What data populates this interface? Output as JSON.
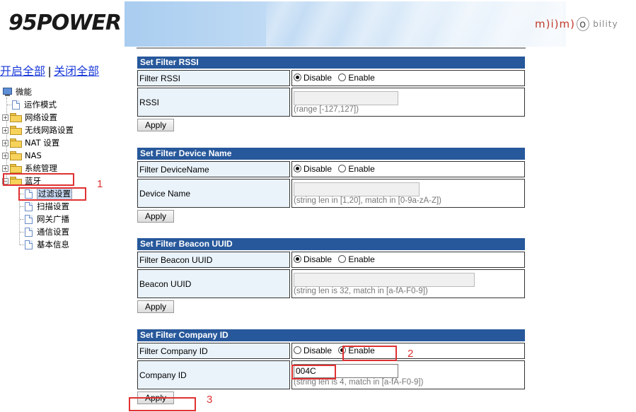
{
  "header": {
    "logo_text": "95POWER",
    "brand2": {
      "m": "m",
      "i": "i",
      "m2": "m",
      "o": "o",
      "rest": "bility"
    }
  },
  "toplinks": {
    "open_all": "开启全部",
    "separator": "|",
    "close_all": "关闭全部"
  },
  "tree": {
    "root": "微能",
    "items": [
      {
        "label": "运作模式"
      },
      {
        "label": "网络设置"
      },
      {
        "label": "无线网路设置"
      },
      {
        "label": "NAT 设置"
      },
      {
        "label": "NAS"
      },
      {
        "label": "系统管理"
      },
      {
        "label": "蓝牙"
      }
    ],
    "bluetooth_children": [
      {
        "label": "过滤设置"
      },
      {
        "label": "扫描设置"
      },
      {
        "label": "网关广播"
      },
      {
        "label": "通信设置"
      },
      {
        "label": "基本信息"
      }
    ]
  },
  "annotations": {
    "n1": "1",
    "n2": "2",
    "n3": "3"
  },
  "sections": {
    "rssi": {
      "title": "Set Filter RSSI",
      "row1_label": "Filter RSSI",
      "row2_label": "RSSI",
      "disable": "Disable",
      "enable": "Enable",
      "selected": "Disable",
      "value": "",
      "hint": "(range [-127,127])",
      "apply": "Apply"
    },
    "devname": {
      "title": "Set Filter Device Name",
      "row1_label": "Filter DeviceName",
      "row2_label": "Device Name",
      "disable": "Disable",
      "enable": "Enable",
      "selected": "Disable",
      "value": "",
      "hint": "(string len in [1,20], match in [0-9a-zA-Z])",
      "apply": "Apply"
    },
    "uuid": {
      "title": "Set Filter Beacon UUID",
      "row1_label": "Filter Beacon UUID",
      "row2_label": "Beacon UUID",
      "disable": "Disable",
      "enable": "Enable",
      "selected": "Disable",
      "value": "",
      "hint": "(string len is 32, match in [a-fA-F0-9])",
      "apply": "Apply"
    },
    "company": {
      "title": "Set Filter Company ID",
      "row1_label": "Filter Company ID",
      "row2_label": "Company ID",
      "disable": "Disable",
      "enable": "Enable",
      "selected": "Enable",
      "value": "004C",
      "hint": "(string len is 4, match in [a-fA-F0-9])",
      "apply": "Apply"
    }
  },
  "colors": {
    "section_header": "#27589b",
    "label_bg": "#eaf3fa",
    "annotation_red": "#e03131",
    "link": "#1a3ad9"
  }
}
